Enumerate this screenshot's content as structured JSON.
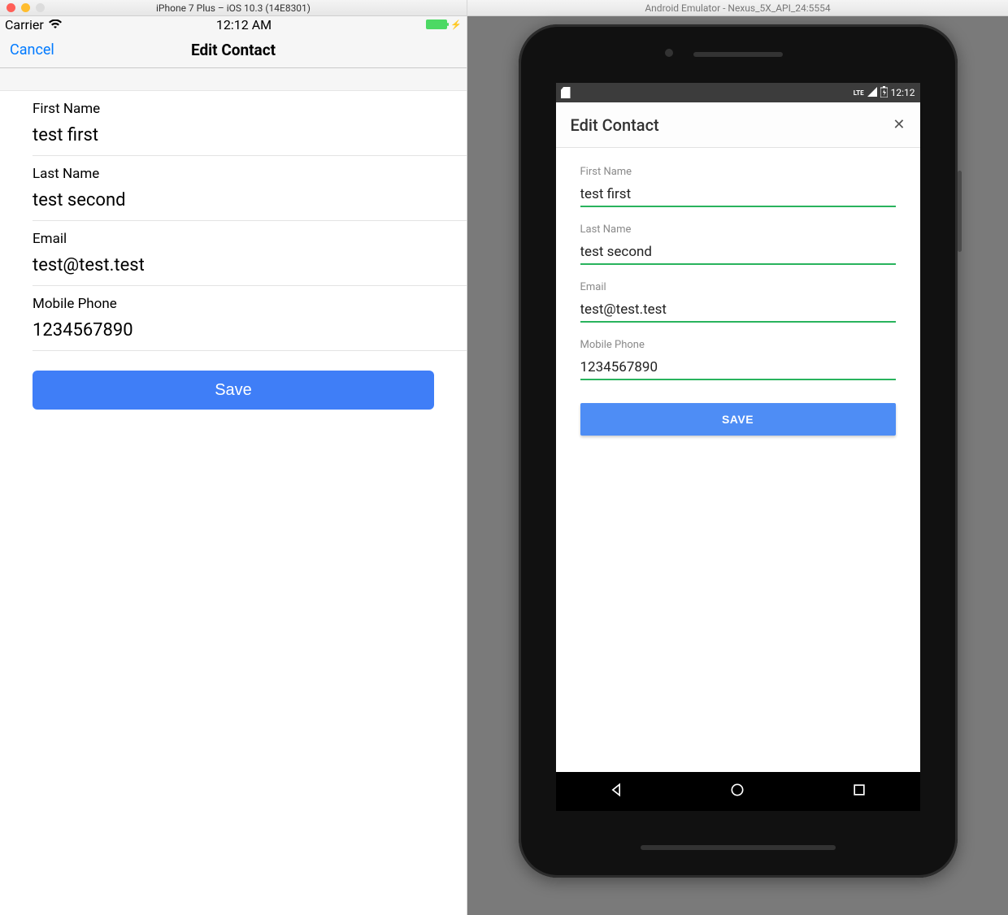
{
  "ios": {
    "window_title": "iPhone 7 Plus – iOS 10.3 (14E8301)",
    "status": {
      "carrier": "Carrier",
      "time": "12:12 AM"
    },
    "nav": {
      "cancel": "Cancel",
      "title": "Edit Contact"
    },
    "fields": {
      "first_name_label": "First Name",
      "first_name_value": "test first",
      "last_name_label": "Last Name",
      "last_name_value": "test second",
      "email_label": "Email",
      "email_value": "test@test.test",
      "phone_label": "Mobile Phone",
      "phone_value": "1234567890"
    },
    "save_label": "Save",
    "traffic_colors": {
      "red": "#ff5f57",
      "yellow": "#ffbd2e",
      "gray": "#dcdcdc"
    }
  },
  "android": {
    "window_title": "Android Emulator - Nexus_5X_API_24:5554",
    "status": {
      "time": "12:12",
      "lte": "LTE"
    },
    "appbar": {
      "title": "Edit Contact",
      "close_glyph": "✕"
    },
    "fields": {
      "first_name_label": "First Name",
      "first_name_value": "test first",
      "last_name_label": "Last Name",
      "last_name_value": "test second",
      "email_label": "Email",
      "email_value": "test@test.test",
      "phone_label": "Mobile Phone",
      "phone_value": "1234567890"
    },
    "save_label": "SAVE"
  }
}
